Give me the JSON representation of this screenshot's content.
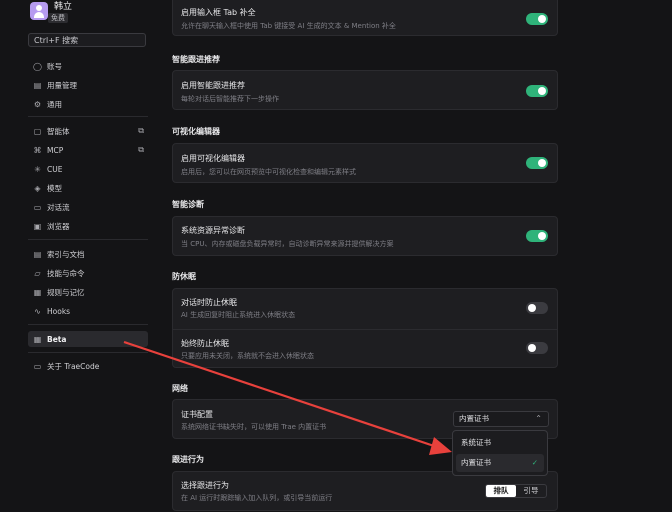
{
  "user": {
    "name": "韩立",
    "plan": "免费"
  },
  "search": {
    "label": "Ctrl+F 搜索"
  },
  "sidebar": {
    "group1": [
      {
        "label": "账号",
        "icon": "user-circle-icon"
      },
      {
        "label": "用量管理",
        "icon": "chart-icon"
      },
      {
        "label": "通用",
        "icon": "gear-icon"
      }
    ],
    "group2": [
      {
        "label": "智能体",
        "icon": "bot-icon",
        "external": true
      },
      {
        "label": "MCP",
        "icon": "mcp-icon",
        "external": true
      },
      {
        "label": "CUE",
        "icon": "cue-icon"
      },
      {
        "label": "模型",
        "icon": "cube-icon"
      },
      {
        "label": "对话流",
        "icon": "chat-flow-icon"
      },
      {
        "label": "浏览器",
        "icon": "browser-icon"
      }
    ],
    "group3": [
      {
        "label": "索引与文档",
        "icon": "index-icon"
      },
      {
        "label": "技能与命令",
        "icon": "skill-icon"
      },
      {
        "label": "规则与记忆",
        "icon": "rule-icon"
      },
      {
        "label": "Hooks",
        "icon": "hook-icon"
      }
    ],
    "beta": {
      "label": "Beta",
      "icon": "beta-icon"
    },
    "about": {
      "label": "关于 TraeCode",
      "icon": "info-icon"
    }
  },
  "settings": {
    "tab": {
      "title": "启用输入框 Tab 补全",
      "desc": "允许在聊天输入框中使用 Tab 键接受 AI 生成的文本 & Mention 补全",
      "on": true
    },
    "smart_follow": {
      "section": "智能跟进推荐",
      "title": "启用智能跟进推荐",
      "desc": "每轮对话后智能推荐下一步操作",
      "on": true
    },
    "visual_editor": {
      "section": "可视化编辑器",
      "title": "启用可视化编辑器",
      "desc": "启用后，您可以在网页预览中可视化检查和编辑元素样式",
      "on": true
    },
    "diagnosis": {
      "section": "智能诊断",
      "title": "系统资源异常诊断",
      "desc": "当 CPU、内存或磁盘负载异常时，自动诊断异常来源并提供解决方案",
      "on": true
    },
    "anti_sleep": {
      "section": "防休眠",
      "items": [
        {
          "title": "对话时防止休眠",
          "desc": "AI 生成回复时阻止系统进入休眠状态",
          "on": false
        },
        {
          "title": "始终防止休眠",
          "desc": "只要应用未关闭，系统就不会进入休眠状态",
          "on": false
        }
      ]
    },
    "network": {
      "section": "网络",
      "title": "证书配置",
      "desc": "系统网络证书缺失时，可以使用 Trae 内置证书",
      "selected": "内置证书",
      "options": [
        "系统证书",
        "内置证书"
      ]
    },
    "follow": {
      "section": "跟进行为",
      "title": "选择跟进行为",
      "desc": "在 AI 运行时跟踪输入加入队列，或引导当前运行",
      "options": [
        "排队",
        "引导"
      ],
      "selected": "排队"
    }
  },
  "colors": {
    "accent": "#2fb37a",
    "arrow": "#e8413c"
  }
}
